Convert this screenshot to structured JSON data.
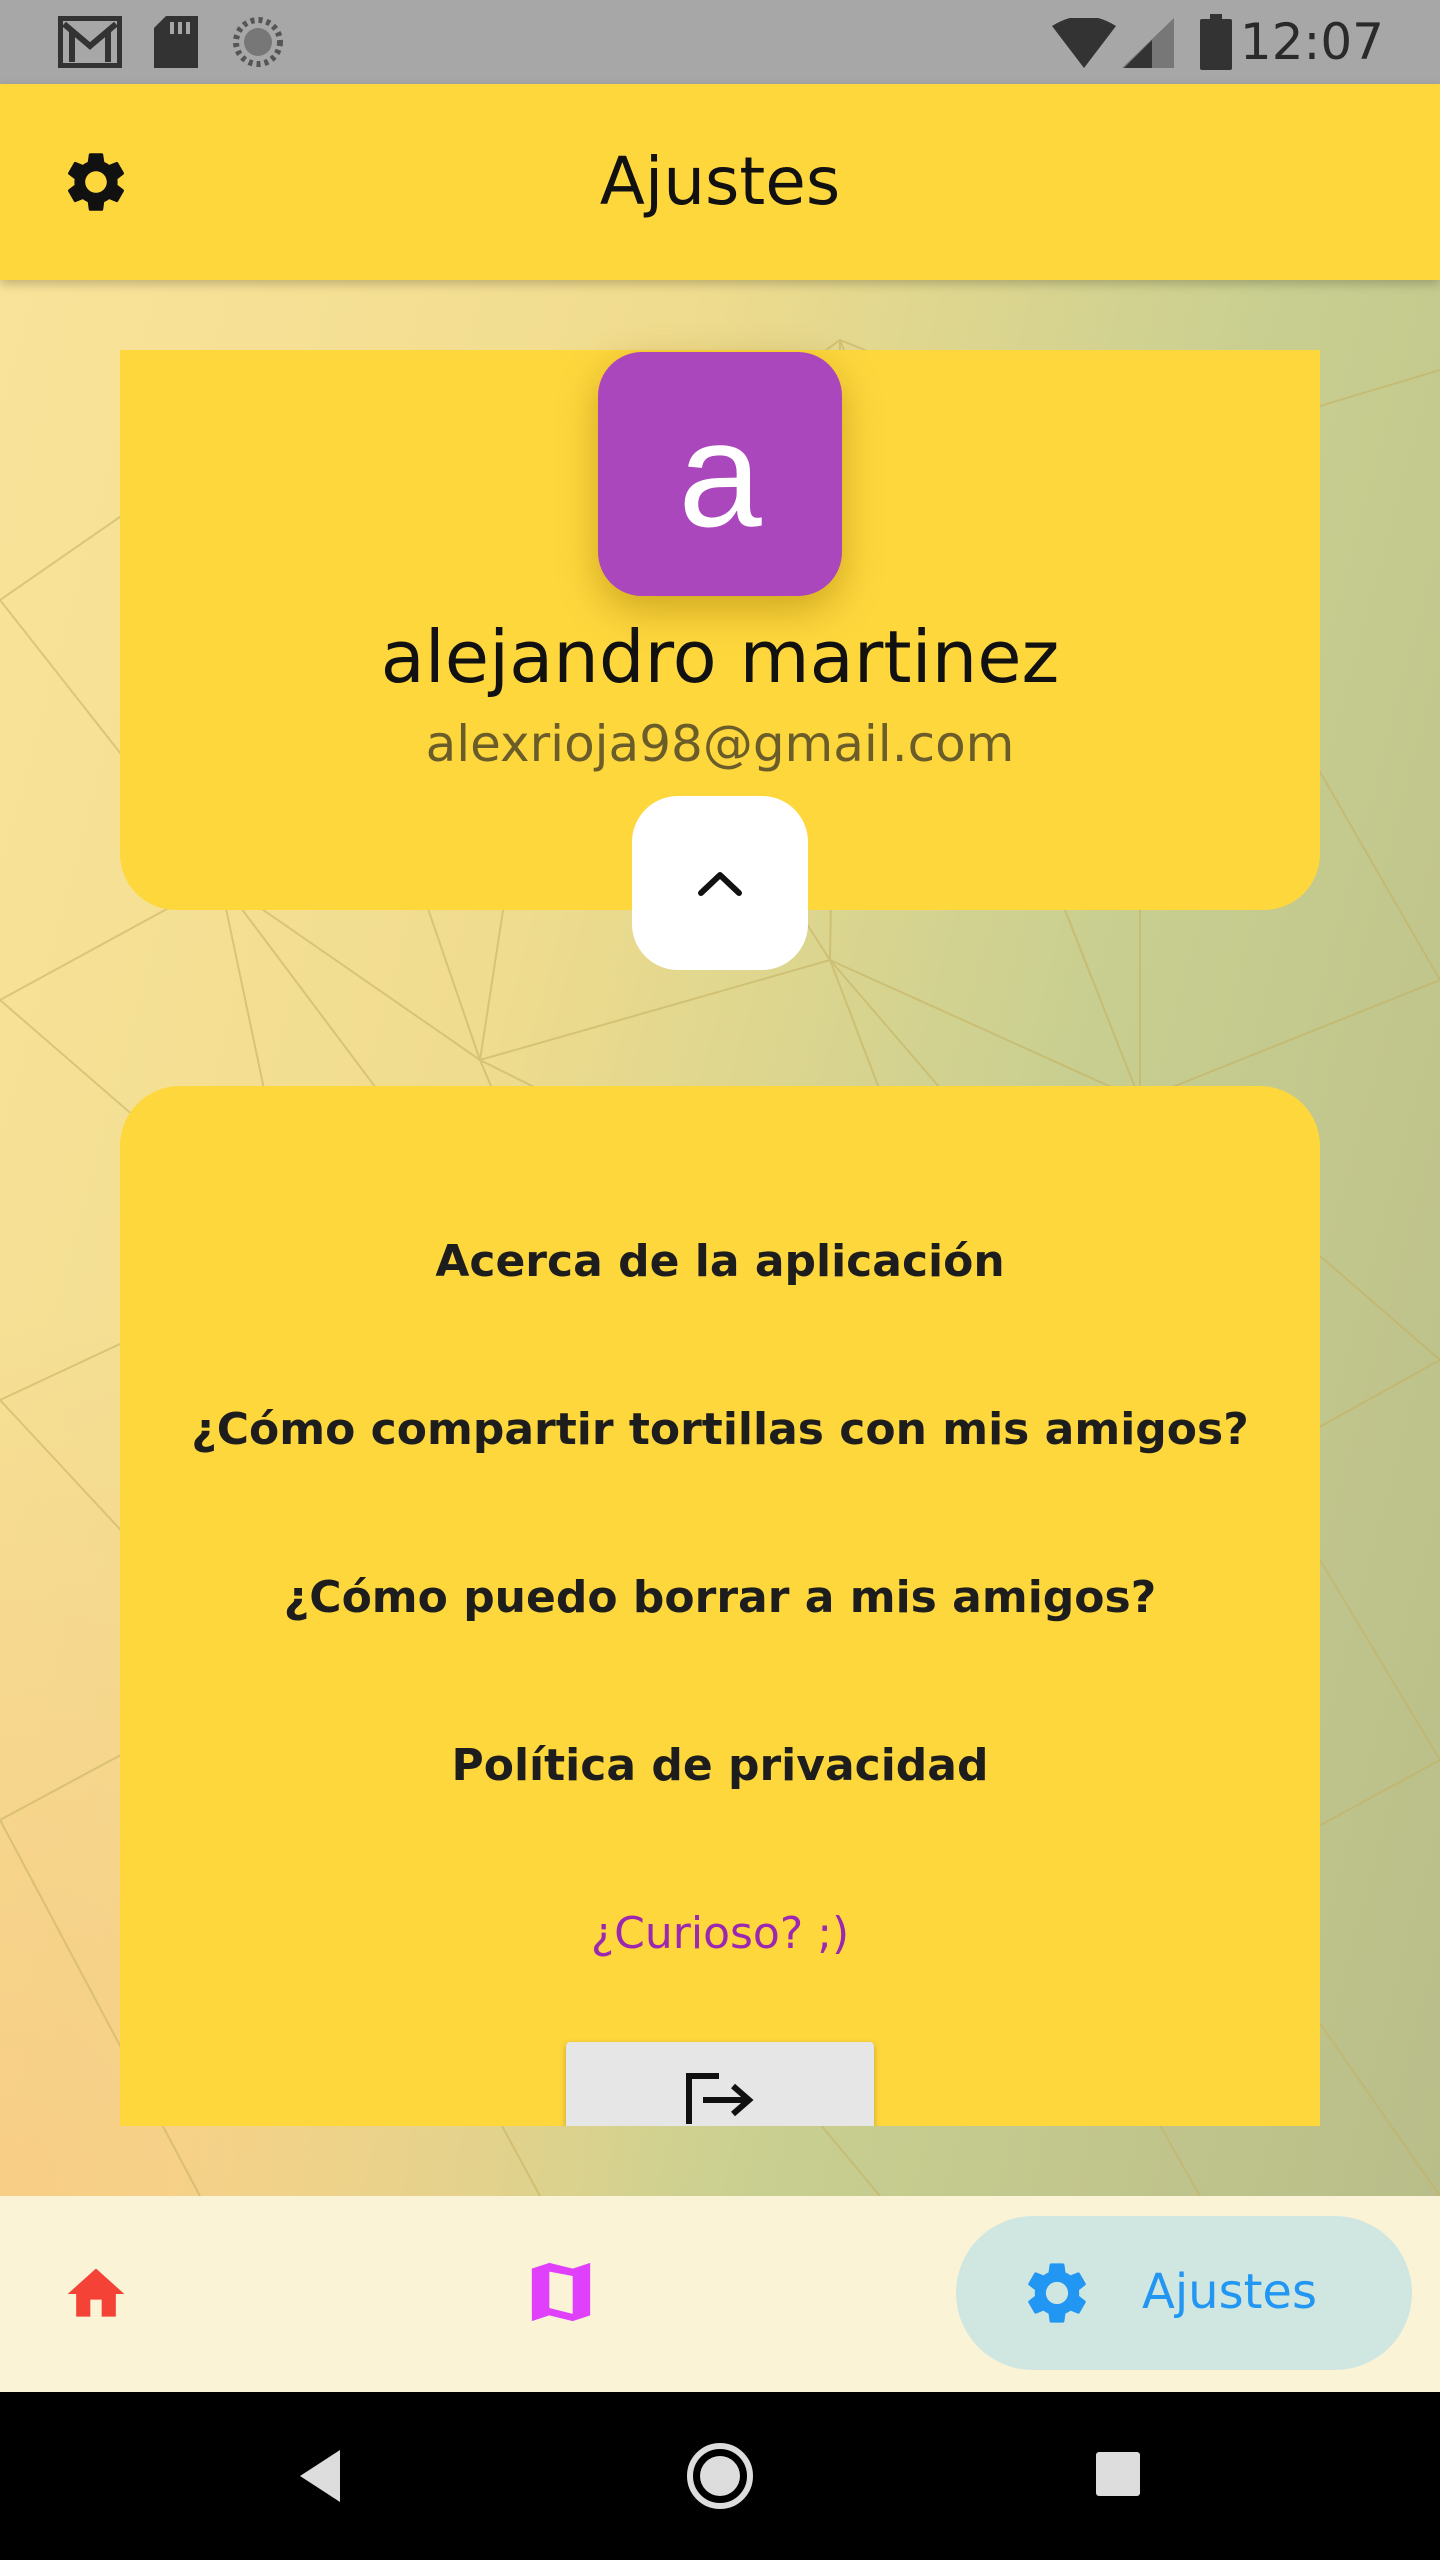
{
  "status_bar": {
    "time": "12:07",
    "left_icons": [
      "gmail-icon",
      "sd-card-icon",
      "sync-icon"
    ],
    "right_icons": [
      "wifi-icon",
      "signal-icon",
      "battery-icon"
    ]
  },
  "app_bar": {
    "title": "Ajustes",
    "icon": "gear-icon"
  },
  "profile": {
    "avatar_letter": "a",
    "avatar_color": "#ab47bc",
    "name": "alejandro martinez",
    "email": "alexrioja98@gmail.com",
    "collapse_icon": "chevron-up-icon"
  },
  "menu": {
    "items": [
      "Acerca de la aplicación",
      "¿Cómo compartir tortillas con mis amigos?",
      "¿Cómo puedo borrar a mis amigos?",
      "Política de privacidad"
    ],
    "curious_link": "¿Curioso? ;)",
    "logout_icon": "logout-icon"
  },
  "bottom_nav": {
    "items": [
      {
        "icon": "home-icon",
        "color": "#f44336"
      },
      {
        "icon": "map-icon",
        "color": "#e040fb"
      },
      {
        "icon": "gear-icon",
        "label": "Ajustes",
        "color": "#2196f3",
        "active": true
      }
    ]
  },
  "colors": {
    "primary_yellow": "#fed73d",
    "accent_purple": "#ab47bc",
    "active_blue": "#2196f3"
  }
}
